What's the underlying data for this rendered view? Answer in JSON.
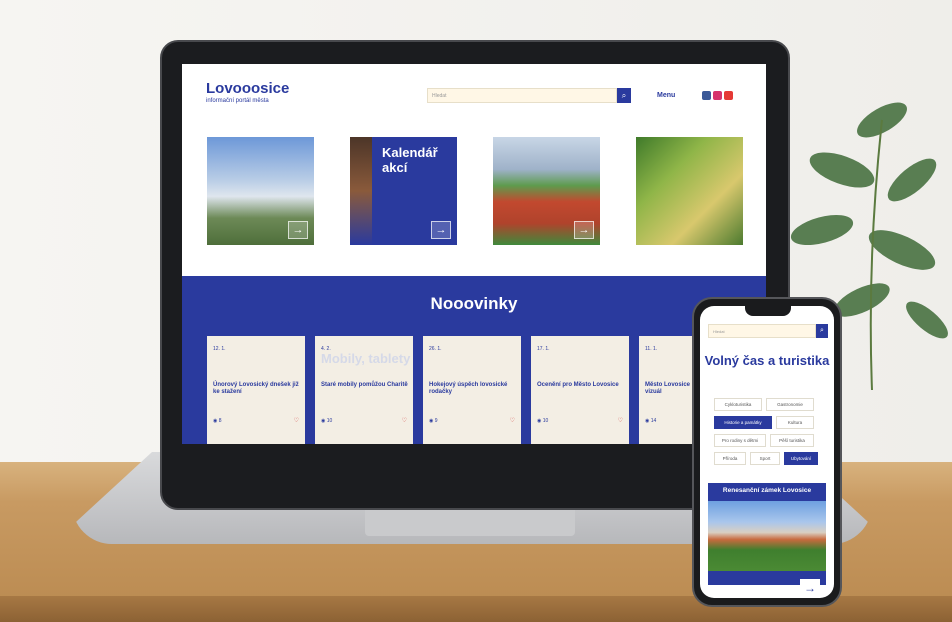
{
  "colors": {
    "brand_blue": "#2a3a9e",
    "cream": "#f3eee4",
    "heart_red": "#d23b3b"
  },
  "laptop_site": {
    "logo": "Lovooosice",
    "logo_sub": "informační portál města",
    "search_placeholder": "Hledat",
    "search_icon": "search-icon",
    "menu_label": "Menu",
    "social_icons": [
      "facebook-icon",
      "instagram-icon",
      "youtube-icon"
    ],
    "tiles": [
      {
        "label": ""
      },
      {
        "label": "Kalendář akcí"
      },
      {
        "label": ""
      },
      {
        "label": ""
      }
    ],
    "news_title": "Nooovinky",
    "news": [
      {
        "date": "12. 1.",
        "title": "Únorový Lovosický dnešek již ke stažení",
        "views": "8",
        "big": ""
      },
      {
        "date": "4. 2.",
        "title": "Staré mobily pomůžou Charitě",
        "views": "10",
        "big": "Mobily, tablety"
      },
      {
        "date": "26. 1.",
        "title": "Hokejový úspěch lovosické rodačky",
        "views": "9",
        "big": ""
      },
      {
        "date": "17. 1.",
        "title": "Ocenění pro Město Lovosice",
        "views": "10",
        "big": ""
      },
      {
        "date": "11. 1.",
        "title": "Město Lovosice má novou vizuál",
        "views": "14",
        "big": ""
      }
    ]
  },
  "phone_site": {
    "search_placeholder": "Hledat",
    "title": "Volný čas a turistika",
    "chips": [
      {
        "label": "Cykloturistika",
        "on": false
      },
      {
        "label": "Gastronomie",
        "on": false
      },
      {
        "label": "Historie a památky",
        "on": true
      },
      {
        "label": "Kultura",
        "on": false
      },
      {
        "label": "Pro rodiny s dětmi",
        "on": false
      },
      {
        "label": "Pěší turistika",
        "on": false
      },
      {
        "label": "Příroda",
        "on": false
      },
      {
        "label": "Sport",
        "on": false
      },
      {
        "label": "Ubytování",
        "on": true
      }
    ],
    "feature_caption": "Renesanční zámek Lovosice"
  }
}
